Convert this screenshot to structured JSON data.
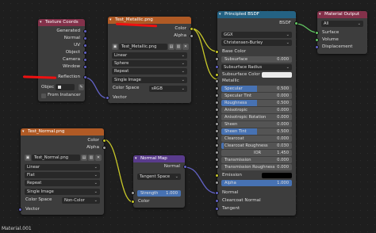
{
  "texture_coords": {
    "title": "Texture Coords",
    "outputs": [
      "Generated",
      "Normal",
      "UV",
      "Object",
      "Camera",
      "Window",
      "Reflection"
    ],
    "object_label": "Objec",
    "from_instancer": "From Instancer"
  },
  "metallic": {
    "title": "Test_Metallic.png",
    "outputs": [
      "Color",
      "Alpha"
    ],
    "image_name": "Test_Metallic.png",
    "interpolation": "Linear",
    "projection": "Sphere",
    "extension": "Repeat",
    "source": "Single Image",
    "color_space_label": "Color Space",
    "color_space": "sRGB",
    "vector": "Vector"
  },
  "normal_tex": {
    "title": "Test_Normal.png",
    "outputs": [
      "Color",
      "Alpha"
    ],
    "image_name": "Test_Normal.png",
    "interpolation": "Linear",
    "projection": "Flat",
    "extension": "Repeat",
    "source": "Single Image",
    "color_space_label": "Color Space",
    "color_space": "Non-Color",
    "vector": "Vector"
  },
  "normal_map": {
    "title": "Normal Map",
    "output": "Normal",
    "space": "Tangent Space",
    "strength_label": "Strength",
    "strength": "1.000",
    "color": "Color"
  },
  "bsdf": {
    "title": "Principled BSDF",
    "output": "BSDF",
    "distribution": "GGX",
    "subsurface_method": "Christensen-Burley",
    "base_color": "Base Color",
    "subsurface": {
      "label": "Subsurface",
      "value": "0.000"
    },
    "subsurface_radius": "Subsurface Radius",
    "subsurface_color": "Subsurface Color",
    "metallic": "Metallic",
    "specular": {
      "label": "Specular",
      "value": "0.500"
    },
    "specular_tint": {
      "label": "Specular Tint",
      "value": "0.000"
    },
    "roughness": {
      "label": "Roughness",
      "value": "0.500"
    },
    "anisotropic": {
      "label": "Anisotropic",
      "value": "0.000"
    },
    "anisotropic_rotation": {
      "label": "Anisotropic Rotation",
      "value": "0.000"
    },
    "sheen": {
      "label": "Sheen",
      "value": "0.000"
    },
    "sheen_tint": {
      "label": "Sheen Tint",
      "value": "0.500"
    },
    "clearcoat": {
      "label": "Clearcoat",
      "value": "0.000"
    },
    "clearcoat_roughness": {
      "label": "Clearcoat Roughness",
      "value": "0.030"
    },
    "ior": {
      "label": "IOR",
      "value": "1.450"
    },
    "transmission": {
      "label": "Transmission",
      "value": "0.000"
    },
    "transmission_roughness": {
      "label": "Transmission Roughness",
      "value": "0.000"
    },
    "emission": "Emission",
    "alpha": {
      "label": "Alpha",
      "value": "1.000"
    },
    "normal": "Normal",
    "clearcoat_normal": "Clearcoat Normal",
    "tangent": "Tangent"
  },
  "material_output": {
    "title": "Material Output",
    "target": "All",
    "inputs": [
      "Surface",
      "Volume",
      "Displacement"
    ]
  },
  "footer": "Material.001",
  "colors": {
    "accent": "#4772b3",
    "texture_header": "#b05a25",
    "shader_header": "#246283",
    "vector_header": "#593b8c",
    "input_header": "#83314a",
    "annotation": "#ee1111"
  }
}
